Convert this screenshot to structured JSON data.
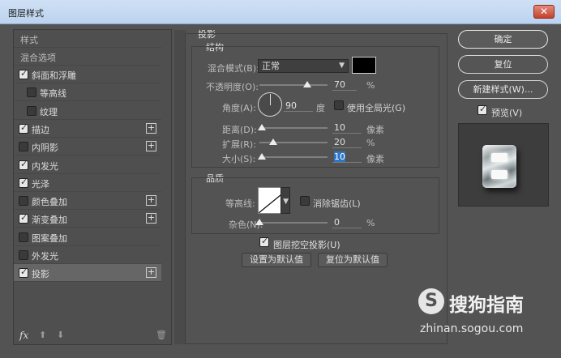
{
  "window": {
    "title": "图层样式",
    "close_label": "✕"
  },
  "styles_list": {
    "header": "样式",
    "blend_options": "混合选项",
    "items": [
      {
        "label": "斜面和浮雕",
        "checked": true,
        "plus": false,
        "indent": false
      },
      {
        "label": "等高线",
        "checked": false,
        "plus": false,
        "indent": true
      },
      {
        "label": "纹理",
        "checked": false,
        "plus": false,
        "indent": true
      },
      {
        "label": "描边",
        "checked": true,
        "plus": true,
        "indent": false
      },
      {
        "label": "内阴影",
        "checked": false,
        "plus": true,
        "indent": false
      },
      {
        "label": "内发光",
        "checked": true,
        "plus": false,
        "indent": false
      },
      {
        "label": "光泽",
        "checked": true,
        "plus": false,
        "indent": false
      },
      {
        "label": "颜色叠加",
        "checked": false,
        "plus": true,
        "indent": false
      },
      {
        "label": "渐变叠加",
        "checked": true,
        "plus": true,
        "indent": false
      },
      {
        "label": "图案叠加",
        "checked": false,
        "plus": false,
        "indent": false
      },
      {
        "label": "外发光",
        "checked": false,
        "plus": false,
        "indent": false
      },
      {
        "label": "投影",
        "checked": true,
        "plus": true,
        "indent": false,
        "active": true
      }
    ],
    "footer": {
      "fx": "fx",
      "up": "⬆",
      "down": "⬇",
      "trash": "🗑"
    }
  },
  "drop_shadow": {
    "section_title": "投影",
    "structure_title": "结构",
    "blend_mode_label": "混合模式(B):",
    "blend_mode_value": "正常",
    "opacity_label": "不透明度(O):",
    "opacity_value": "70",
    "opacity_unit": "%",
    "opacity": 70,
    "angle_label": "角度(A):",
    "angle_value": "90",
    "angle_unit": "度",
    "global_light_label": "使用全局光(G)",
    "distance_label": "距离(D):",
    "distance_value": "10",
    "distance_unit": "像素",
    "distance_level": 0.04,
    "spread_label": "扩展(R):",
    "spread_value": "20",
    "spread_unit": "%",
    "spread_level": 0.2,
    "size_label": "大小(S):",
    "size_value": "10",
    "size_unit": "像素",
    "size_level": 0.04,
    "quality_title": "品质",
    "contour_label": "等高线:",
    "antialias_label": "消除锯齿(L)",
    "noise_label": "杂色(N):",
    "noise_value": "0",
    "noise_unit": "%",
    "noise_level": 0,
    "knockout_label": "图层挖空投影(U)",
    "set_default_label": "设置为默认值",
    "reset_default_label": "复位为默认值",
    "shadow_color": "#000000"
  },
  "actions": {
    "ok": "确定",
    "reset": "复位",
    "new_style": "新建样式(W)...",
    "preview_label": "预览(V)"
  },
  "watermark": {
    "brand": "搜狗指南",
    "url": "zhinan.sogou.com",
    "logo_letter": "S"
  }
}
